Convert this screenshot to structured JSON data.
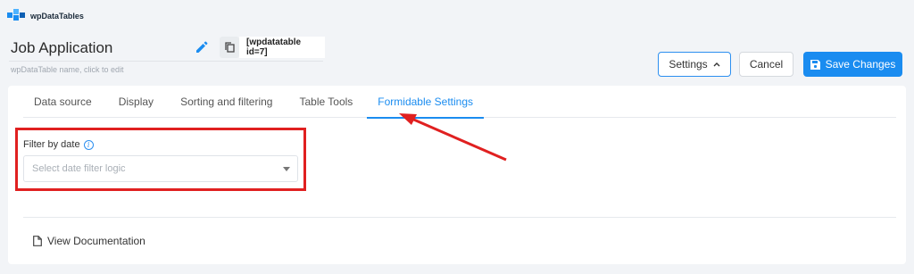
{
  "app": {
    "name": "wpDataTables"
  },
  "header": {
    "title": "Job Application",
    "title_hint": "wpDataTable name, click to edit",
    "shortcode": "[wpdatatable id=7]"
  },
  "toolbar": {
    "settings_label": "Settings",
    "cancel_label": "Cancel",
    "save_label": "Save Changes"
  },
  "tabs": [
    {
      "label": "Data source",
      "active": false
    },
    {
      "label": "Display",
      "active": false
    },
    {
      "label": "Sorting and filtering",
      "active": false
    },
    {
      "label": "Table Tools",
      "active": false
    },
    {
      "label": "Formidable Settings",
      "active": true
    }
  ],
  "filter": {
    "label": "Filter by date",
    "placeholder": "Select date filter logic"
  },
  "footer": {
    "doc_link": "View Documentation"
  },
  "colors": {
    "accent": "#1a8cf0",
    "highlight": "#e02020",
    "background": "#f2f4f7"
  },
  "icons": [
    "wpdatatables-logo",
    "pencil-icon",
    "copy-icon",
    "chevron-up-icon",
    "floppy-disk-icon",
    "info-icon",
    "chevron-down-icon",
    "document-icon"
  ]
}
